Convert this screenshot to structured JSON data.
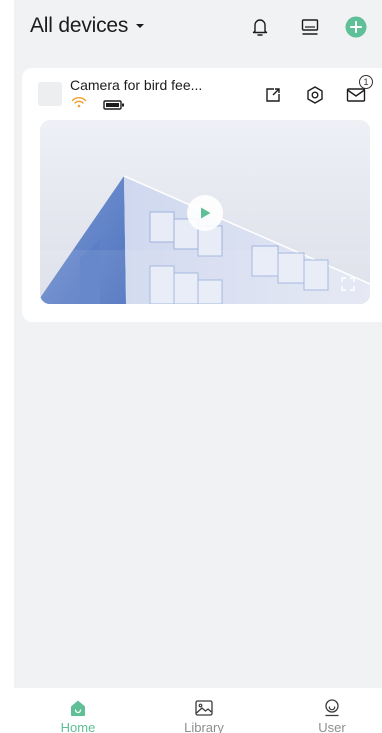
{
  "header": {
    "title": "All devices",
    "icons": [
      "bell-icon",
      "devices-icon",
      "add-icon"
    ]
  },
  "device_card": {
    "name": "Camera for bird fee...",
    "status_icons": [
      "wifi-icon",
      "battery-icon"
    ],
    "actions": [
      "share-icon",
      "settings-icon",
      "message-icon"
    ],
    "message_badge": "1",
    "preview": {
      "play_icon": "play-icon",
      "fullscreen_icon": "fullscreen-icon"
    }
  },
  "nav": {
    "items": [
      {
        "label": "Home",
        "icon": "home-icon",
        "active": true
      },
      {
        "label": "Library",
        "icon": "library-icon",
        "active": false
      },
      {
        "label": "User",
        "icon": "user-icon",
        "active": false
      }
    ]
  },
  "colors": {
    "accent": "#5fbf96",
    "wifi": "#f0a12c",
    "background": "#f1f2f4",
    "card": "#ffffff",
    "inactive_label": "#8e8e93"
  }
}
